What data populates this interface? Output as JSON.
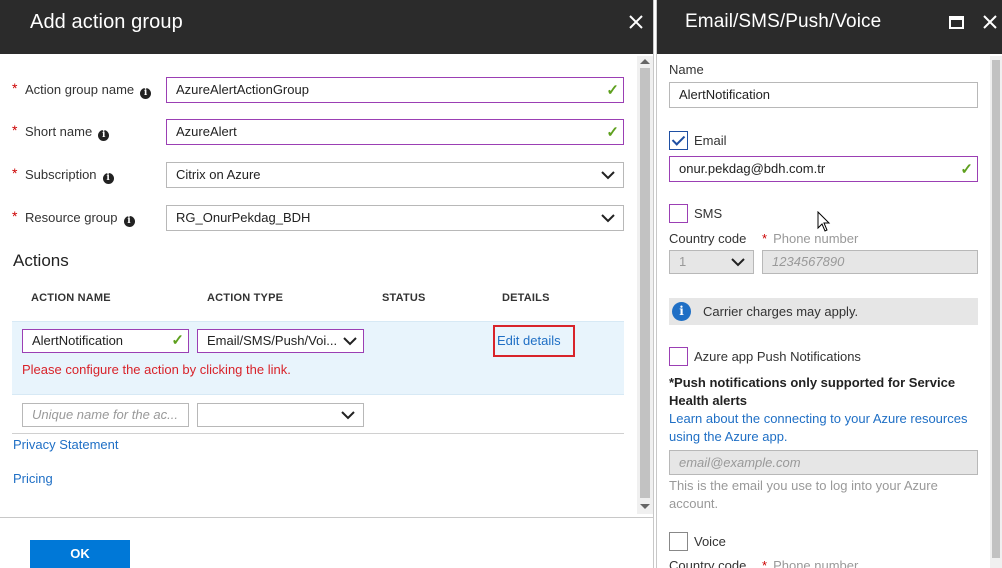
{
  "left_blade": {
    "title": "Add action group",
    "close_icon": "close-icon",
    "fields": {
      "action_group_name": {
        "label": "Action group name",
        "value": "AzureAlertActionGroup"
      },
      "short_name": {
        "label": "Short name",
        "value": "AzureAlert"
      },
      "subscription": {
        "label": "Subscription",
        "value": "Citrix on Azure"
      },
      "resource_group": {
        "label": "Resource group",
        "value": "RG_OnurPekdag_BDH"
      }
    },
    "actions": {
      "title": "Actions",
      "columns": [
        "ACTION NAME",
        "ACTION TYPE",
        "STATUS",
        "DETAILS"
      ],
      "rows": [
        {
          "name": "AlertNotification",
          "type": "Email/SMS/Push/Voi...",
          "status": "",
          "details_link": "Edit details",
          "error": "Please configure the action by clicking the link."
        }
      ],
      "new_row": {
        "name_placeholder": "Unique name for the ac...",
        "type_value": ""
      }
    },
    "links": {
      "privacy": "Privacy Statement",
      "pricing": "Pricing"
    },
    "ok_label": "OK"
  },
  "right_blade": {
    "title": "Email/SMS/Push/Voice",
    "name_label": "Name",
    "name_value": "AlertNotification",
    "email": {
      "label": "Email",
      "checked": true,
      "value": "onur.pekdag@bdh.com.tr"
    },
    "sms": {
      "label": "SMS",
      "checked": false,
      "country_code_label": "Country code",
      "country_code_value": "1",
      "phone_label": "Phone number",
      "phone_placeholder": "1234567890"
    },
    "carrier_note": "Carrier charges may apply.",
    "push": {
      "label": "Azure app Push Notifications",
      "checked": false,
      "note": "*Push notifications only supported for Service Health alerts",
      "link": "Learn about the connecting to your Azure resources using the Azure app.",
      "email_placeholder": "email@example.com",
      "helper": "This is the email you use to log into your Azure account."
    },
    "voice": {
      "label": "Voice",
      "checked": false,
      "country_code_label": "Country code",
      "phone_label": "Phone number"
    }
  },
  "colors": {
    "header_bg": "#2b2b2b",
    "accent_blue": "#0078d7",
    "link_blue": "#1f6fc5",
    "valid_border": "#9b3fb4",
    "error_red": "#d8232a",
    "check_green": "#5ea01e"
  }
}
